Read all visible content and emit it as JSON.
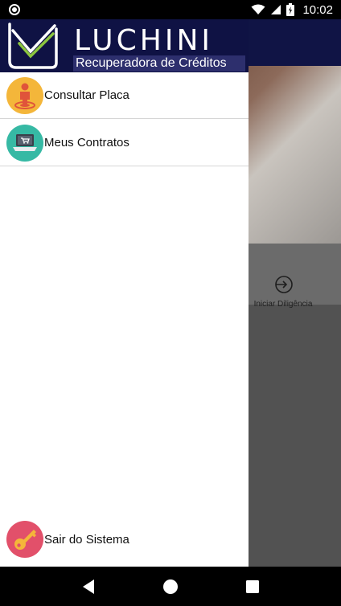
{
  "status_bar": {
    "time": "10:02",
    "battery_glyph": "⚡"
  },
  "background_app": {
    "action_label": "Iniciar Diligência"
  },
  "drawer": {
    "brand_name": "LUCHINI",
    "brand_subtitle": "Recuperadora de Créditos",
    "menu_items": [
      {
        "label": "Consultar Placa",
        "icon": "person-target-icon",
        "color": "#f4b63a"
      },
      {
        "label": "Meus Contratos",
        "icon": "laptop-cart-icon",
        "color": "#36b9a4"
      }
    ],
    "footer_item": {
      "label": "Sair do Sistema",
      "icon": "key-icon",
      "color": "#e2506a"
    }
  },
  "nav_bar": {
    "buttons": [
      "back-icon",
      "home-icon",
      "recents-icon"
    ]
  },
  "colors": {
    "header_bg": "#0f1244",
    "subtitle_bg": "#2d2f6d",
    "accent_green": "#8cc63f"
  }
}
